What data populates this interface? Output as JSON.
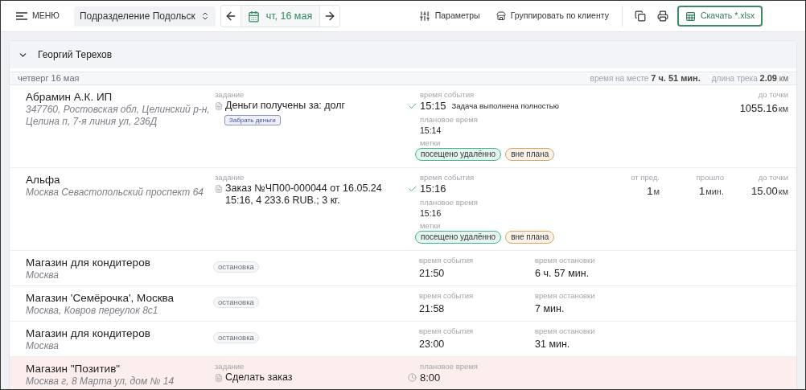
{
  "toolbar": {
    "menu": "МЕНЮ",
    "division": "Подразделение Подольск",
    "date": "чт, 16 мая",
    "params": "Параметры",
    "group_by": "Группировать по клиенту",
    "download": "Скачать *.xlsx"
  },
  "group": {
    "title": "Георгий Терехов",
    "expanded": true,
    "day": "четверг 16 мая",
    "time_label": "время на месте",
    "time_value": "7 ч. 51 мин.",
    "track_label": "длина трека",
    "track_value": "2.09",
    "track_unit": "км"
  },
  "rows": [
    {
      "kind": "visit",
      "highlighted": false,
      "name": "Абрамин А.К. ИП",
      "address": "347760, Ростовская обл, Целинский р-н, Целина п, 7-я линия ул, 236Д",
      "task": {
        "label": "задание",
        "text": "Деньги получены за: долг",
        "action": "Забрать деньги"
      },
      "event": {
        "label": "время события",
        "time": "15:15",
        "done": true,
        "note": "Задача выполнена полностью"
      },
      "plan": {
        "label": "плановое время",
        "time": "15:14"
      },
      "tags": {
        "label": "метки",
        "items": [
          {
            "text": "посещено удалённо",
            "color": "#3fb68b"
          },
          {
            "text": "вне плана",
            "color": "#e2a35a"
          }
        ]
      },
      "stats": [
        {
          "label": "до точки",
          "value": "1055.16",
          "unit": "км"
        }
      ]
    },
    {
      "kind": "visit",
      "highlighted": false,
      "name": "Альфа",
      "address": "Москва Севастопольский проспект 64",
      "task": {
        "label": "задание",
        "text": "Заказ №ЧП00-000044 от 16.05.24 15:16, 4 233.6 RUB.; 3 кг."
      },
      "event": {
        "label": "время события",
        "time": "15:16",
        "done": true
      },
      "plan": {
        "label": "плановое время",
        "time": "15:16"
      },
      "tags": {
        "label": "метки",
        "items": [
          {
            "text": "посещено удалённо",
            "color": "#3fb68b"
          },
          {
            "text": "вне плана",
            "color": "#e2a35a"
          }
        ]
      },
      "stats": [
        {
          "label": "от пред.",
          "value": "1",
          "unit": "м"
        },
        {
          "label": "прошло",
          "value": "1",
          "unit": "мин."
        },
        {
          "label": "до точки",
          "value": "15.00",
          "unit": "км"
        }
      ]
    },
    {
      "kind": "stop",
      "highlighted": false,
      "name": "Магазин для кондитеров",
      "address": "Москва",
      "badge": "остановка",
      "event": {
        "label": "время события",
        "time": "21:50"
      },
      "duration": {
        "label": "время остановки",
        "value": "6 ч. 57 мин."
      }
    },
    {
      "kind": "stop",
      "highlighted": false,
      "name": "Магазин 'Семёрочка', Москва",
      "address": "Москва, Ковров переулок 8с1",
      "badge": "остановка",
      "event": {
        "label": "время события",
        "time": "21:58"
      },
      "duration": {
        "label": "время остановки",
        "value": "7 мин."
      }
    },
    {
      "kind": "stop",
      "highlighted": false,
      "name": "Магазин для кондитеров",
      "address": "Москва",
      "badge": "остановка",
      "event": {
        "label": "время события",
        "time": "23:00"
      },
      "duration": {
        "label": "время остановки",
        "value": "31 мин."
      }
    },
    {
      "kind": "visit",
      "highlighted": true,
      "name": "Магазин \"Позитив\"",
      "address": "Москва г, 8 Марта ул, дом № 14",
      "task": {
        "label": "задание",
        "text": "Сделать заказ"
      },
      "plan": {
        "label": "плановое время",
        "time": "8:00"
      }
    }
  ]
}
